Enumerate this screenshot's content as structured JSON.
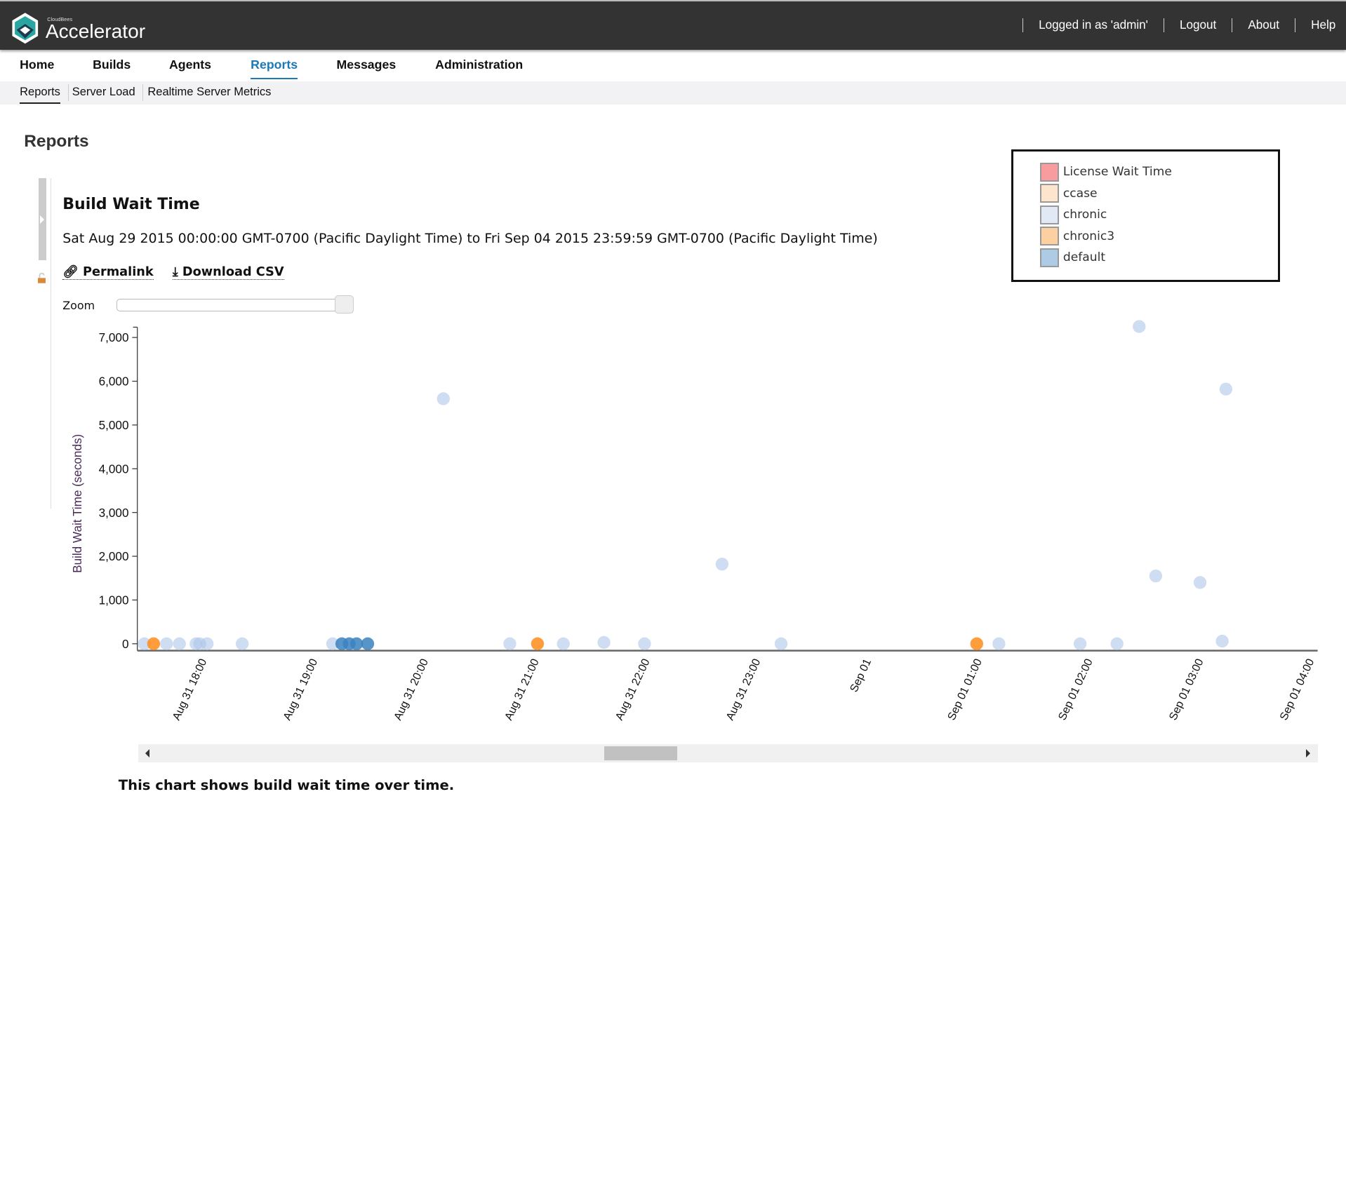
{
  "header": {
    "brand_small": "CloudBees",
    "brand": "Accelerator",
    "links": [
      "Logged in as 'admin'",
      "Logout",
      "About",
      "Help"
    ]
  },
  "nav": {
    "items": [
      "Home",
      "Builds",
      "Agents",
      "Reports",
      "Messages",
      "Administration"
    ],
    "active": "Reports"
  },
  "subnav": {
    "items": [
      "Reports",
      "Server Load",
      "Realtime Server Metrics"
    ],
    "active": "Reports"
  },
  "page": {
    "title": "Reports"
  },
  "report": {
    "title": "Build Wait Time",
    "range": "Sat Aug 29 2015 00:00:00 GMT-0700 (Pacific Daylight Time) to Fri Sep 04 2015 23:59:59 GMT-0700 (Pacific Daylight Time)",
    "permalink": "Permalink",
    "download": "Download CSV",
    "zoom_label": "Zoom",
    "caption": "This chart shows build wait time over time."
  },
  "legend": [
    {
      "name": "License Wait Time",
      "color": "#f99ca0"
    },
    {
      "name": "ccase",
      "color": "#fde4cc"
    },
    {
      "name": "chronic",
      "color": "#e2e9f6"
    },
    {
      "name": "chronic3",
      "color": "#fdd0a2"
    },
    {
      "name": "default",
      "color": "#aecbe5"
    }
  ],
  "chart_data": {
    "type": "scatter",
    "ylabel": "Build Wait Time (seconds)",
    "ylim": [
      0,
      7000
    ],
    "yticks": [
      "0",
      "1,000",
      "2,000",
      "3,000",
      "4,000",
      "5,000",
      "6,000",
      "7,000"
    ],
    "xlim": [
      "2015-08-31T17:24",
      "2015-09-01T04:04"
    ],
    "xticks": [
      {
        "t": "2015-08-31T18:00",
        "label": "Aug 31 18:00"
      },
      {
        "t": "2015-08-31T19:00",
        "label": "Aug 31 19:00"
      },
      {
        "t": "2015-08-31T20:00",
        "label": "Aug 31 20:00"
      },
      {
        "t": "2015-08-31T21:00",
        "label": "Aug 31 21:00"
      },
      {
        "t": "2015-08-31T22:00",
        "label": "Aug 31 22:00"
      },
      {
        "t": "2015-08-31T23:00",
        "label": "Aug 31 23:00"
      },
      {
        "t": "2015-09-01T00:00",
        "label": "Sep 01"
      },
      {
        "t": "2015-09-01T01:00",
        "label": "Sep 01 01:00"
      },
      {
        "t": "2015-09-01T02:00",
        "label": "Sep 01 02:00"
      },
      {
        "t": "2015-09-01T03:00",
        "label": "Sep 01 03:00"
      },
      {
        "t": "2015-09-01T04:00",
        "label": "Sep 01 04:00"
      }
    ],
    "series": [
      {
        "name": "chronic",
        "color": "#aec7e8",
        "points": [
          [
            "2015-08-31T17:28",
            0
          ],
          [
            "2015-08-31T17:40",
            0
          ],
          [
            "2015-08-31T17:47",
            0
          ],
          [
            "2015-08-31T17:56",
            0
          ],
          [
            "2015-08-31T17:58",
            0
          ],
          [
            "2015-08-31T18:02",
            0
          ],
          [
            "2015-08-31T18:21",
            0
          ],
          [
            "2015-08-31T19:10",
            0
          ],
          [
            "2015-08-31T20:10",
            5600
          ],
          [
            "2015-08-31T20:46",
            0
          ],
          [
            "2015-08-31T21:15",
            0
          ],
          [
            "2015-08-31T21:37",
            30
          ],
          [
            "2015-08-31T21:59",
            0
          ],
          [
            "2015-08-31T22:41",
            1820
          ],
          [
            "2015-08-31T23:13",
            0
          ],
          [
            "2015-09-01T01:11",
            0
          ],
          [
            "2015-09-01T01:55",
            0
          ],
          [
            "2015-09-01T02:15",
            0
          ],
          [
            "2015-09-01T02:27",
            7250
          ],
          [
            "2015-09-01T02:36",
            1550
          ],
          [
            "2015-09-01T03:00",
            1400
          ],
          [
            "2015-09-01T03:12",
            60
          ],
          [
            "2015-09-01T03:14",
            5820
          ]
        ]
      },
      {
        "name": "default",
        "color": "#3a83c0",
        "points": [
          [
            "2015-08-31T19:15",
            0
          ],
          [
            "2015-08-31T19:19",
            0
          ],
          [
            "2015-08-31T19:23",
            0
          ],
          [
            "2015-08-31T19:29",
            0
          ]
        ]
      },
      {
        "name": "chronic3",
        "color": "#ff8c1a",
        "points": [
          [
            "2015-08-31T17:33",
            0
          ],
          [
            "2015-08-31T21:01",
            0
          ],
          [
            "2015-09-01T00:59",
            0
          ]
        ]
      }
    ]
  }
}
